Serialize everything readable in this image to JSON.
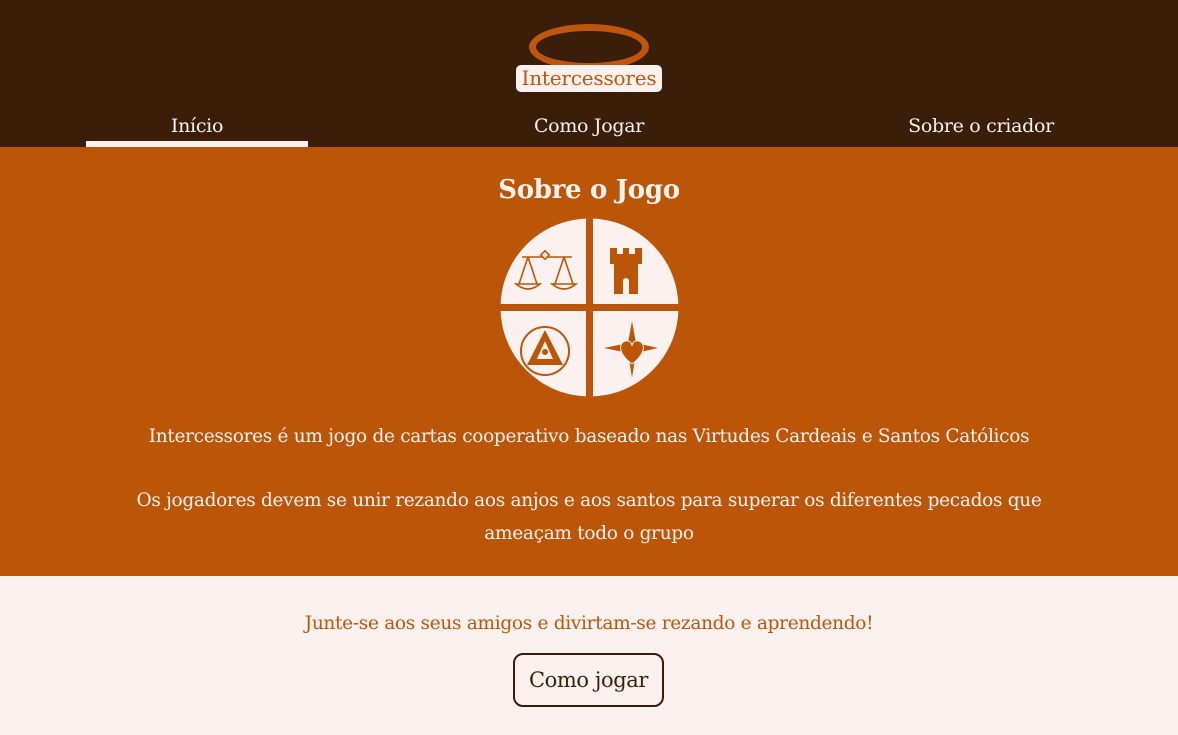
{
  "brand": {
    "logo_text": "Intercessores"
  },
  "nav": {
    "items": [
      {
        "label": "Início",
        "active": true
      },
      {
        "label": "Como Jogar",
        "active": false
      },
      {
        "label": "Sobre o criador",
        "active": false
      }
    ]
  },
  "about": {
    "title": "Sobre o Jogo",
    "paragraph_1": "Intercessores é um jogo de cartas cooperativo baseado nas Virtudes Cardeais e Santos Católicos",
    "paragraph_2": "Os jogadores devem se unir rezando aos anjos e aos santos para superar os diferentes pecados que ameaçam todo o grupo",
    "emblem_icons": [
      "scales-icon",
      "tower-icon",
      "eye-triangle-icon",
      "star-heart-icon"
    ]
  },
  "cta": {
    "text": "Junte-se aos seus amigos e divirtam-se rezando e aprendendo!",
    "button_label": "Como jogar"
  },
  "colors": {
    "header_bg": "#3a1e09",
    "accent_orange": "#bb5508",
    "cream": "#fbf1ef"
  }
}
